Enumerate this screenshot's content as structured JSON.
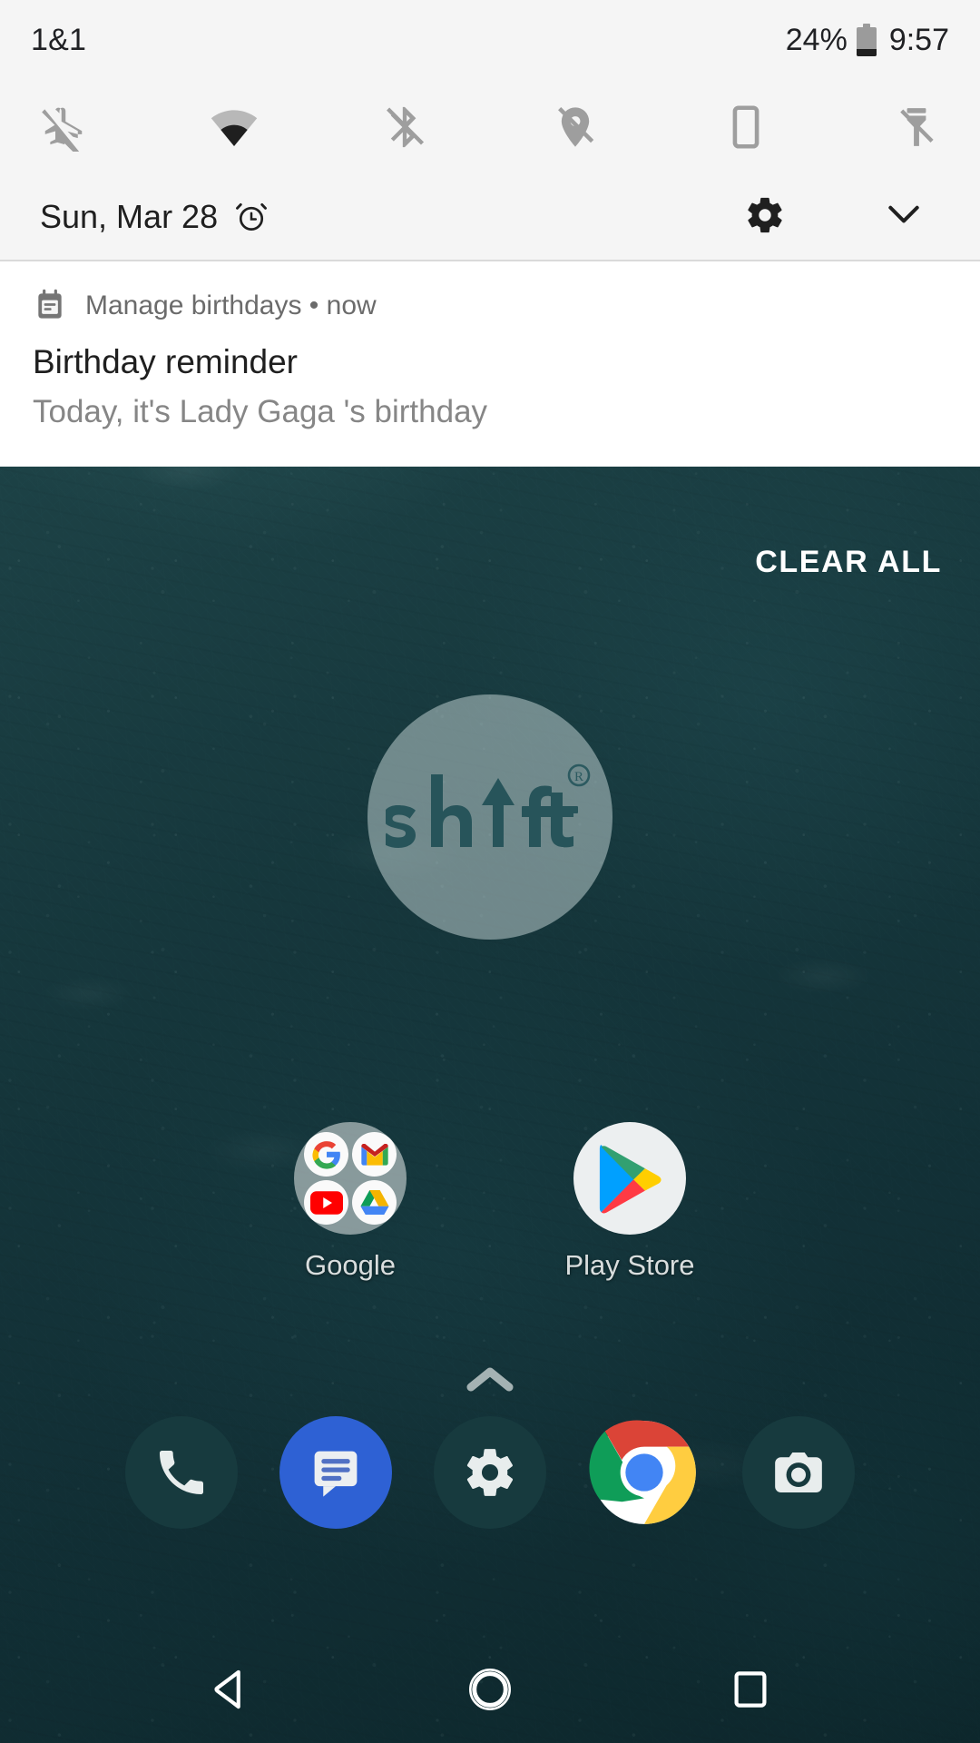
{
  "status_bar": {
    "carrier": "1&1",
    "battery_percent": "24%",
    "battery_level": 24,
    "clock": "9:57"
  },
  "quick_settings": {
    "tiles": [
      {
        "name": "airplane-mode",
        "icon": "airplane-off-icon",
        "enabled": false
      },
      {
        "name": "wifi",
        "icon": "wifi-icon",
        "enabled": true
      },
      {
        "name": "bluetooth",
        "icon": "bluetooth-off-icon",
        "enabled": false
      },
      {
        "name": "location",
        "icon": "location-off-icon",
        "enabled": false
      },
      {
        "name": "auto-rotate",
        "icon": "screen-rotate-icon",
        "enabled": false
      },
      {
        "name": "flashlight",
        "icon": "flashlight-off-icon",
        "enabled": false
      }
    ],
    "date": "Sun, Mar 28",
    "alarm_icon": "alarm-clock-icon",
    "settings_icon": "gear-icon",
    "expand_icon": "chevron-down-icon"
  },
  "notification": {
    "app_line": "Manage birthdays • now",
    "title": "Birthday reminder",
    "body": "Today, it's Lady Gaga 's birthday",
    "icon": "calendar-event-icon"
  },
  "shade": {
    "clear_all_label": "CLEAR ALL"
  },
  "home": {
    "watermark": {
      "brand": "shift",
      "registered_mark": "®"
    },
    "apps": [
      {
        "label": "Google",
        "type": "folder",
        "icon": "google-folder-icon",
        "contents": [
          "google-g-icon",
          "gmail-icon",
          "youtube-icon",
          "google-drive-icon"
        ]
      },
      {
        "label": "Play Store",
        "type": "app",
        "icon": "play-store-icon"
      }
    ],
    "drawer_handle_icon": "chevron-up-icon",
    "dock": [
      {
        "name": "phone",
        "icon": "phone-icon"
      },
      {
        "name": "messages",
        "icon": "messages-icon"
      },
      {
        "name": "settings",
        "icon": "gear-icon"
      },
      {
        "name": "chrome",
        "icon": "chrome-icon"
      },
      {
        "name": "camera",
        "icon": "camera-icon"
      }
    ]
  },
  "nav_bar": {
    "back_icon": "back-triangle-icon",
    "home_icon": "home-circle-icon",
    "recents_icon": "recents-square-icon"
  },
  "colors": {
    "wallpaper_base": "#163a3f",
    "shade_bg": "#f5f5f5",
    "notification_bg": "#ffffff",
    "accent_blue": "#2e61d4",
    "dock_dark": "#173a3e",
    "text_primary": "#1f1f1f",
    "text_secondary": "#868686",
    "icon_inactive": "#9b9b9b",
    "icon_active": "#1f1f1f"
  }
}
